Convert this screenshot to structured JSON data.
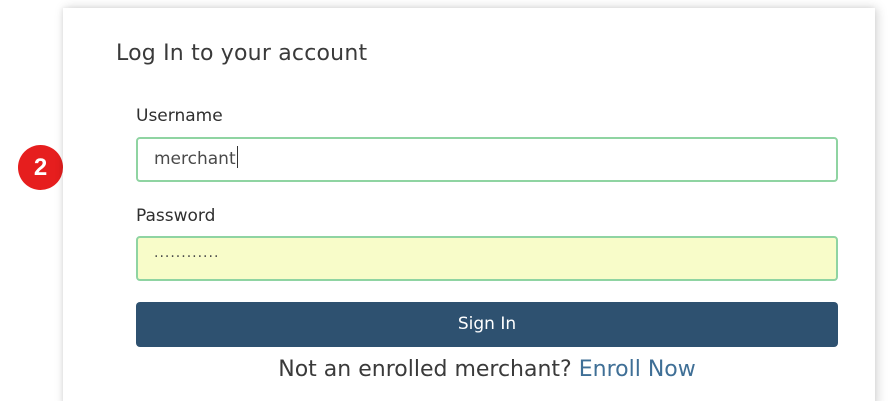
{
  "step_badge": "2",
  "login": {
    "title": "Log In to your account",
    "username_label": "Username",
    "username_value": "merchant",
    "password_label": "Password",
    "password_masked": "············",
    "signin_label": "Sign In",
    "enroll_prompt": "Not an enrolled merchant?",
    "enroll_link": "Enroll Now"
  },
  "colors": {
    "badge": "#e61e1e",
    "button": "#2e5170",
    "link": "#3f6f96",
    "field_border": "#8fd4a2",
    "autofill": "#f8fcc9"
  }
}
